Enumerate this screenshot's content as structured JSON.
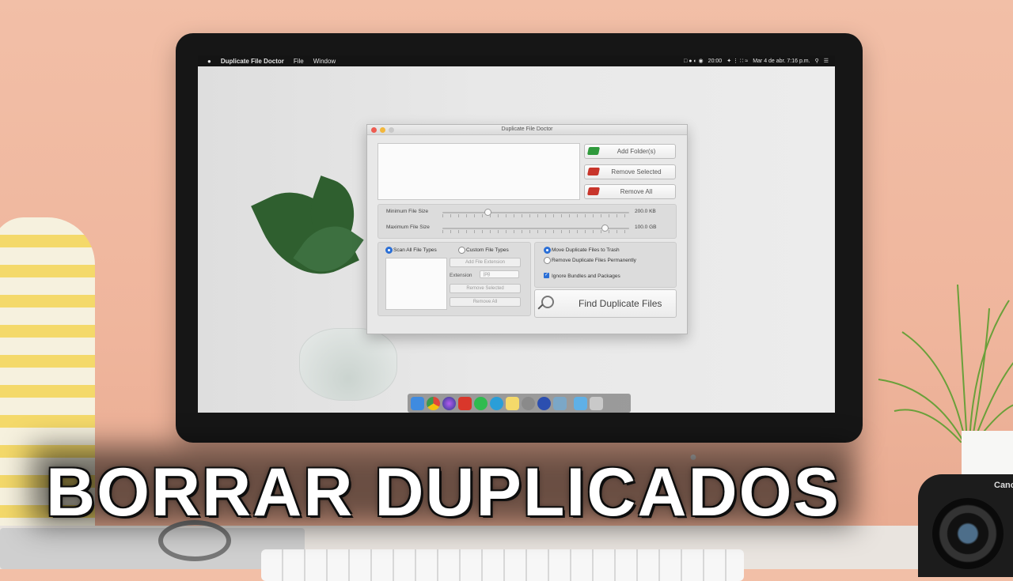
{
  "headline": "BORRAR DUPLICADOS",
  "menubar": {
    "app_name": "Duplicate File Doctor",
    "menus": [
      "File",
      "Window"
    ],
    "clock_left": "20:00",
    "datetime": "Mar 4 de abr.  7:16 p.m."
  },
  "window": {
    "title": "Duplicate File Doctor",
    "buttons": {
      "add_folder": "Add Folder(s)",
      "remove_selected": "Remove Selected",
      "remove_all": "Remove All"
    },
    "min_label": "Minimum File Size",
    "min_value": "200.0 KB",
    "min_fraction": 0.24,
    "max_label": "Maximum File Size",
    "max_value": "100.0 GB",
    "max_fraction": 0.87,
    "scan_all": "Scan All File Types",
    "custom_types": "Custom File Types",
    "add_extension": "Add File Extension",
    "extension_label": "Extension",
    "extension_value": "jpg",
    "ext_remove_selected": "Remove Selected",
    "ext_remove_all": "Remove All",
    "move_to_trash": "Move Duplicate Files to Trash",
    "remove_permanently": "Remove Duplicate Files Permanently",
    "ignore_bundles": "Ignore Bundles and Packages",
    "find_duplicates": "Find Duplicate Files"
  },
  "colors": {
    "accent": "#2b6fd6",
    "wall": "#f0b9a0"
  },
  "camera_brand": "Canon"
}
